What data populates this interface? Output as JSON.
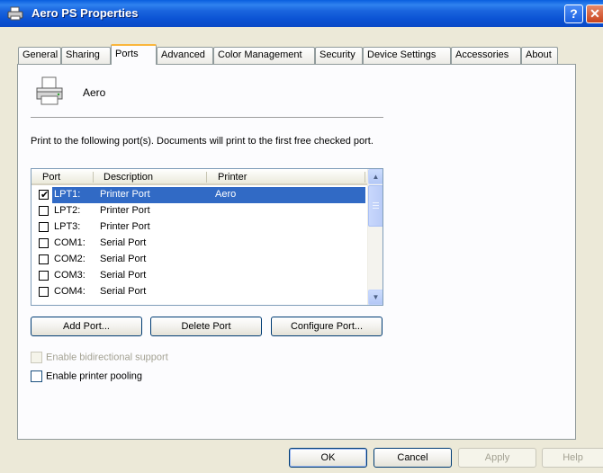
{
  "window": {
    "title": "Aero PS Properties"
  },
  "tabs": [
    {
      "label": "General",
      "active": false
    },
    {
      "label": "Sharing",
      "active": false
    },
    {
      "label": "Ports",
      "active": true
    },
    {
      "label": "Advanced",
      "active": false
    },
    {
      "label": "Color Management",
      "active": false
    },
    {
      "label": "Security",
      "active": false
    },
    {
      "label": "Device Settings",
      "active": false
    },
    {
      "label": "Accessories",
      "active": false
    },
    {
      "label": "About",
      "active": false
    }
  ],
  "printer": {
    "name": "Aero",
    "icon": "printer-icon"
  },
  "ports_description": "Print to the following port(s). Documents will print to the first free checked port.",
  "ports_list": {
    "columns": [
      "Port",
      "Description",
      "Printer"
    ],
    "rows": [
      {
        "port": "LPT1:",
        "description": "Printer Port",
        "printer": "Aero",
        "checked": true,
        "selected": true
      },
      {
        "port": "LPT2:",
        "description": "Printer Port",
        "printer": "",
        "checked": false,
        "selected": false
      },
      {
        "port": "LPT3:",
        "description": "Printer Port",
        "printer": "",
        "checked": false,
        "selected": false
      },
      {
        "port": "COM1:",
        "description": "Serial Port",
        "printer": "",
        "checked": false,
        "selected": false
      },
      {
        "port": "COM2:",
        "description": "Serial Port",
        "printer": "",
        "checked": false,
        "selected": false
      },
      {
        "port": "COM3:",
        "description": "Serial Port",
        "printer": "",
        "checked": false,
        "selected": false
      },
      {
        "port": "COM4:",
        "description": "Serial Port",
        "printer": "",
        "checked": false,
        "selected": false
      }
    ]
  },
  "port_buttons": {
    "add": "Add Port...",
    "delete": "Delete Port",
    "configure": "Configure Port..."
  },
  "options": {
    "bidirectional": {
      "label": "Enable bidirectional support",
      "checked": false,
      "enabled": false
    },
    "pooling": {
      "label": "Enable printer pooling",
      "checked": false,
      "enabled": true
    }
  },
  "dialog_buttons": {
    "ok": "OK",
    "cancel": "Cancel",
    "apply": "Apply",
    "help": "Help"
  },
  "colors": {
    "titlebar": "#0b53d4",
    "selection": "#316ac5",
    "tab_highlight": "#fab63c",
    "face": "#ece9d8"
  }
}
